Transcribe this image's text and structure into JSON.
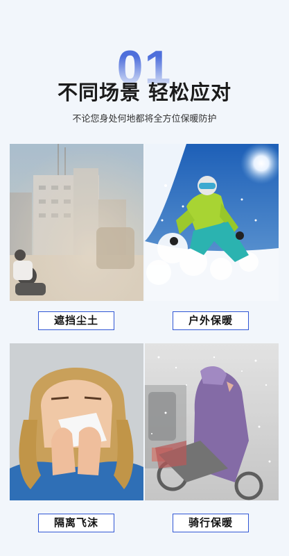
{
  "header": {
    "number": "01",
    "title": "不同场景 轻松应对",
    "subtitle": "不论您身处何地都将全方位保暖防护"
  },
  "scenes": [
    {
      "label": "遮挡尘土",
      "image": "dusty-street-motorcyclist-photo"
    },
    {
      "label": "户外保暖",
      "image": "skier-in-snow-photo"
    },
    {
      "label": "隔离飞沫",
      "image": "woman-sneezing-tissue-photo"
    },
    {
      "label": "骑行保暖",
      "image": "scooter-rider-snowstorm-photo"
    }
  ],
  "colors": {
    "accent": "#2f55d4",
    "background": "#f2f6fb"
  }
}
